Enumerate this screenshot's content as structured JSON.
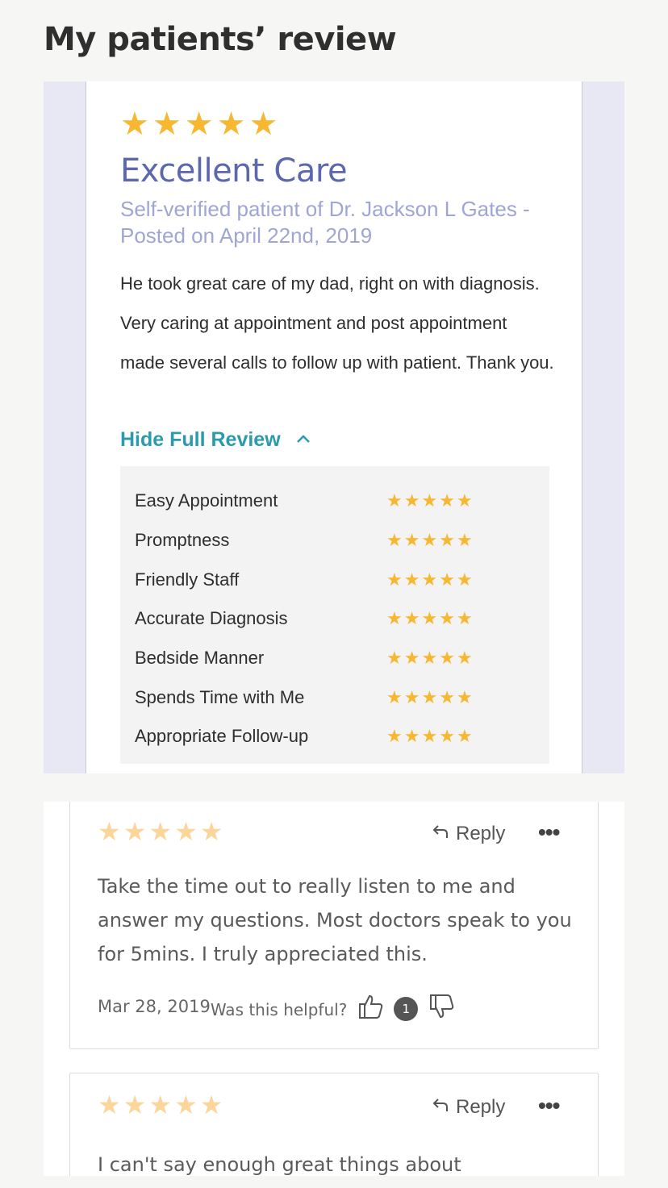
{
  "page": {
    "title": "My patients’ review"
  },
  "featured_review": {
    "stars": 5,
    "title": "Excellent Care",
    "meta": "Self-verified patient of Dr. Jackson L Gates - Posted on April 22nd, 2019",
    "body": "He took great care of my dad, right on with diagnosis. Very caring at appointment and post appointment made several calls to follow up with patient. Thank you.",
    "toggle_label": "Hide Full Review",
    "star_glyph": "★",
    "star_color": "#f7b731",
    "ratings": [
      {
        "label": "Easy Appointment",
        "stars": 5
      },
      {
        "label": "Promptness",
        "stars": 5
      },
      {
        "label": "Friendly Staff",
        "stars": 5
      },
      {
        "label": "Accurate Diagnosis",
        "stars": 5
      },
      {
        "label": "Bedside Manner",
        "stars": 5
      },
      {
        "label": "Spends Time with Me",
        "stars": 5
      },
      {
        "label": "Appropriate Follow-up",
        "stars": 5
      }
    ]
  },
  "reviews": [
    {
      "stars": 5,
      "reply_label": "Reply",
      "more_label": "•••",
      "text": "Take the time out to really listen to me and answer my questions. Most doctors speak to you for 5mins. I truly appreciated this.",
      "date": "Mar 28, 2019",
      "helpful_label": "Was this helpful?",
      "helpful_count": "1"
    },
    {
      "stars": 5,
      "reply_label": "Reply",
      "more_label": "•••",
      "text": "I can't say enough great things about"
    }
  ],
  "colors": {
    "accent_blue": "#5c68ad",
    "teal_link": "#2b9bab",
    "gold_star": "#f7b731",
    "light_star": "#fbd59a"
  }
}
